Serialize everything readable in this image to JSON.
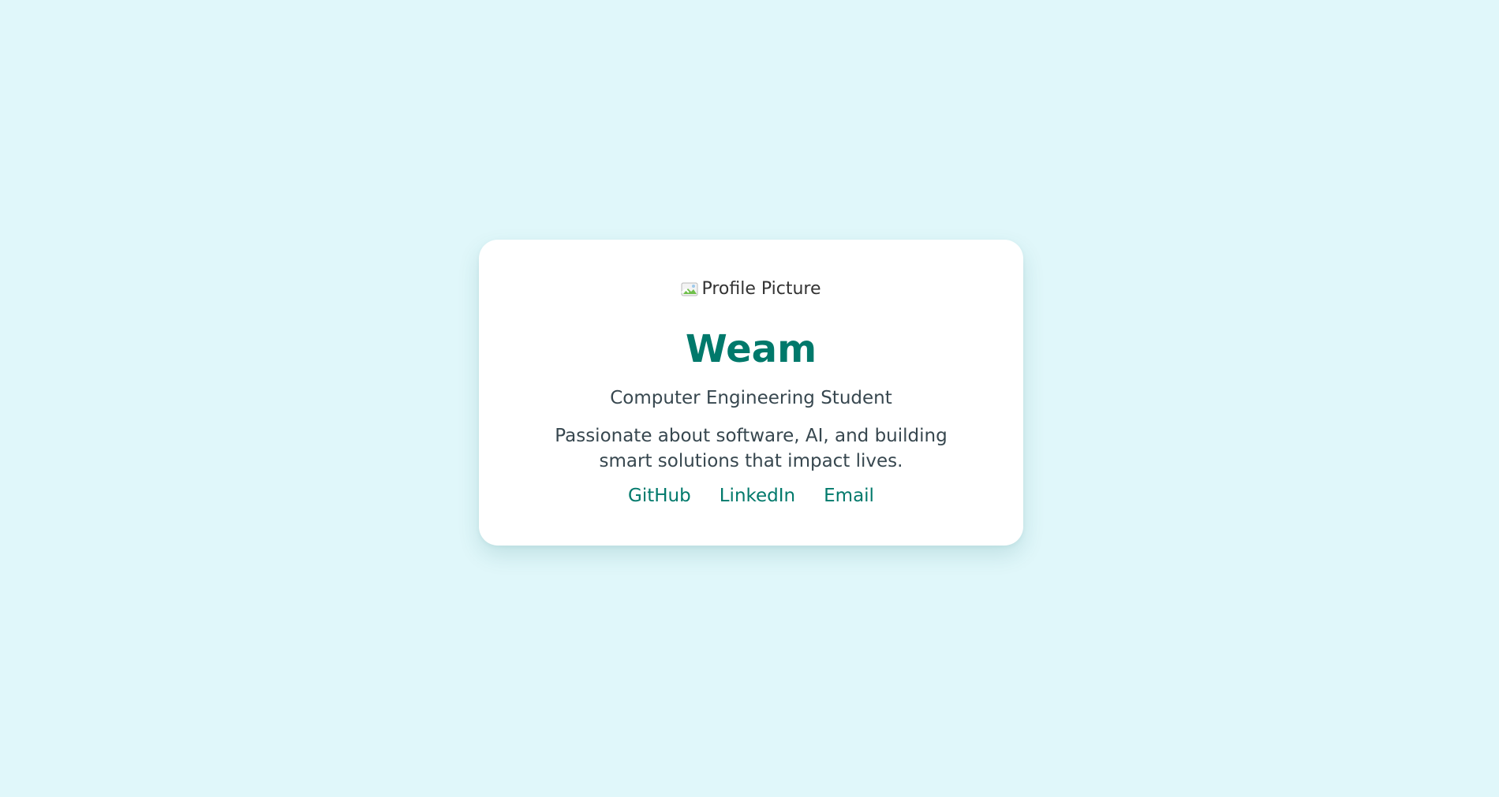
{
  "colors": {
    "background": "#e0f7fa",
    "card": "#ffffff",
    "accent": "#00796b",
    "text": "#37474f"
  },
  "profile": {
    "image_alt": "Profile Picture",
    "image_icon": "broken-image-icon",
    "name": "Weam",
    "role": "Computer Engineering Student",
    "bio": "Passionate about software, AI, and building smart solutions that impact lives."
  },
  "links": [
    {
      "label": "GitHub"
    },
    {
      "label": "LinkedIn"
    },
    {
      "label": "Email"
    }
  ]
}
